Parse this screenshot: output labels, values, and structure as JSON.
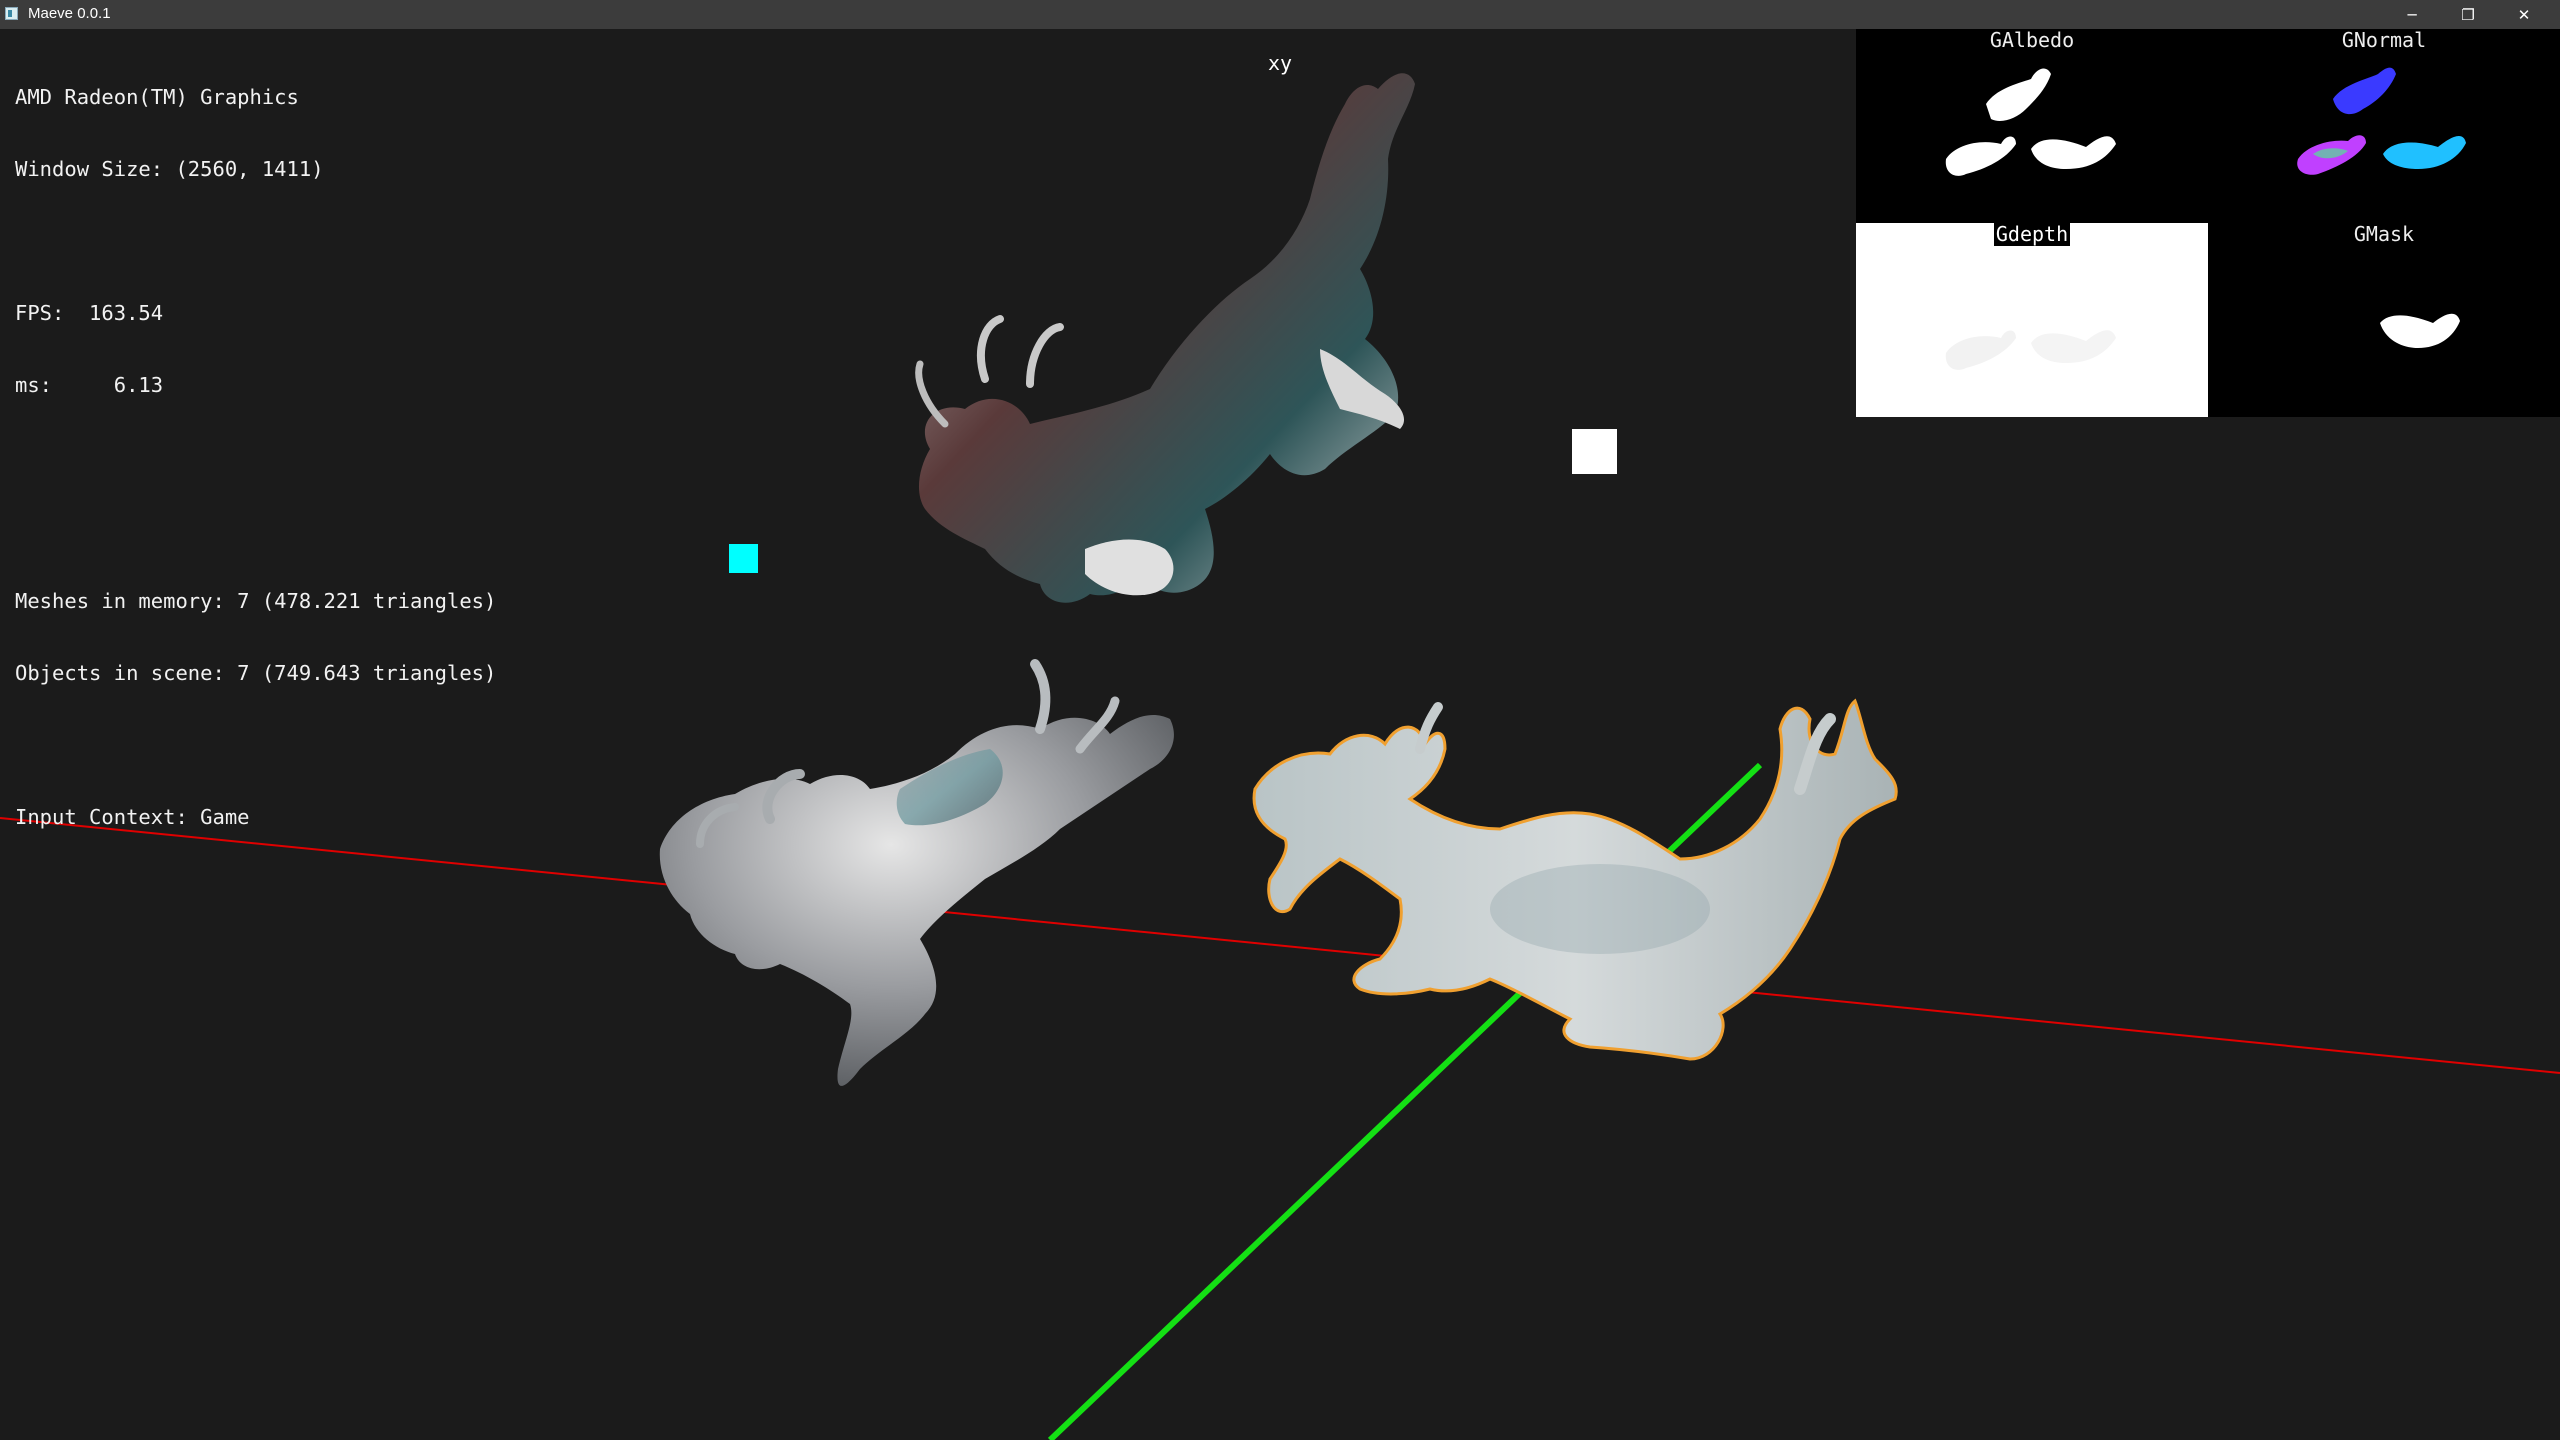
{
  "window": {
    "title": "Maeve 0.0.1",
    "minimize_glyph": "─",
    "maximize_glyph": "❐",
    "close_glyph": "✕"
  },
  "hud": {
    "gpu": "AMD Radeon(TM) Graphics",
    "window_size": "Window Size: (2560, 1411)",
    "fps": "FPS:  163.54",
    "ms": "ms:     6.13",
    "meshes": "Meshes in memory: 7 (478.221 triangles)",
    "objects": "Objects in scene: 7 (749.643 triangles)",
    "input_context": "Input Context: Game"
  },
  "axis_label": "xy",
  "gbuffers": [
    {
      "label": "GAlbedo"
    },
    {
      "label": "GNormal"
    },
    {
      "label": "Gdepth"
    },
    {
      "label": "GMask"
    }
  ],
  "colors": {
    "background": "#1b1b1b",
    "x_axis": "#e00000",
    "y_axis": "#14e014",
    "light_marker_cyan": "#00ffff",
    "light_marker_white": "#ffffff",
    "selection_outline": "#f0a030"
  }
}
